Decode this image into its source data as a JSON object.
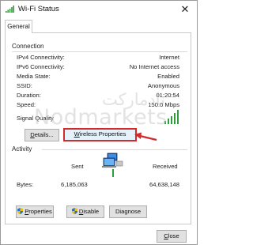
{
  "window": {
    "title": "Wi-Fi Status",
    "close_glyph": "✕"
  },
  "tabs": [
    {
      "label": "General"
    }
  ],
  "connection": {
    "heading": "Connection",
    "rows": [
      {
        "label": "IPv4 Connectivity:",
        "value": "Internet"
      },
      {
        "label": "IPv6 Connectivity:",
        "value": "No Internet access"
      },
      {
        "label": "Media State:",
        "value": "Enabled"
      },
      {
        "label": "SSID:",
        "value": "Anonymous"
      },
      {
        "label": "Duration:",
        "value": "01:20:54"
      },
      {
        "label": "Speed:",
        "value": "150.0 Mbps"
      }
    ],
    "signal_label": "Signal Quality",
    "signal_bars_filled": 5,
    "signal_bars_total": 5,
    "details_button": {
      "pre": "",
      "accel": "D",
      "post": "etails..."
    },
    "wireless_button": {
      "pre": "",
      "accel": "W",
      "post": "ireless Properties"
    }
  },
  "activity": {
    "heading": "Activity",
    "sent_label": "Sent",
    "received_label": "Received",
    "bytes_label": "Bytes:",
    "bytes_sent": "6,185,063",
    "bytes_received": "64,638,148"
  },
  "actions": {
    "properties": {
      "pre": "",
      "accel": "P",
      "post": "roperties"
    },
    "disable": {
      "pre": "",
      "accel": "D",
      "post": "isable"
    },
    "diagnose": {
      "label": "Diagnose"
    }
  },
  "footer": {
    "close": {
      "pre": "",
      "accel": "C",
      "post": "lose"
    }
  },
  "watermark": {
    "latin": "Nodmarkets",
    "persian": "نادمارکت"
  },
  "colors": {
    "signal_green": "#2e9e3a",
    "highlight_red": "#d12c2c",
    "shield_blue": "#2a6fc9",
    "shield_yellow": "#f2c200"
  },
  "icons": {
    "title": "wifi-signal-icon",
    "activity": "network-computer-icon",
    "annotation": "red-arrow-icon"
  }
}
